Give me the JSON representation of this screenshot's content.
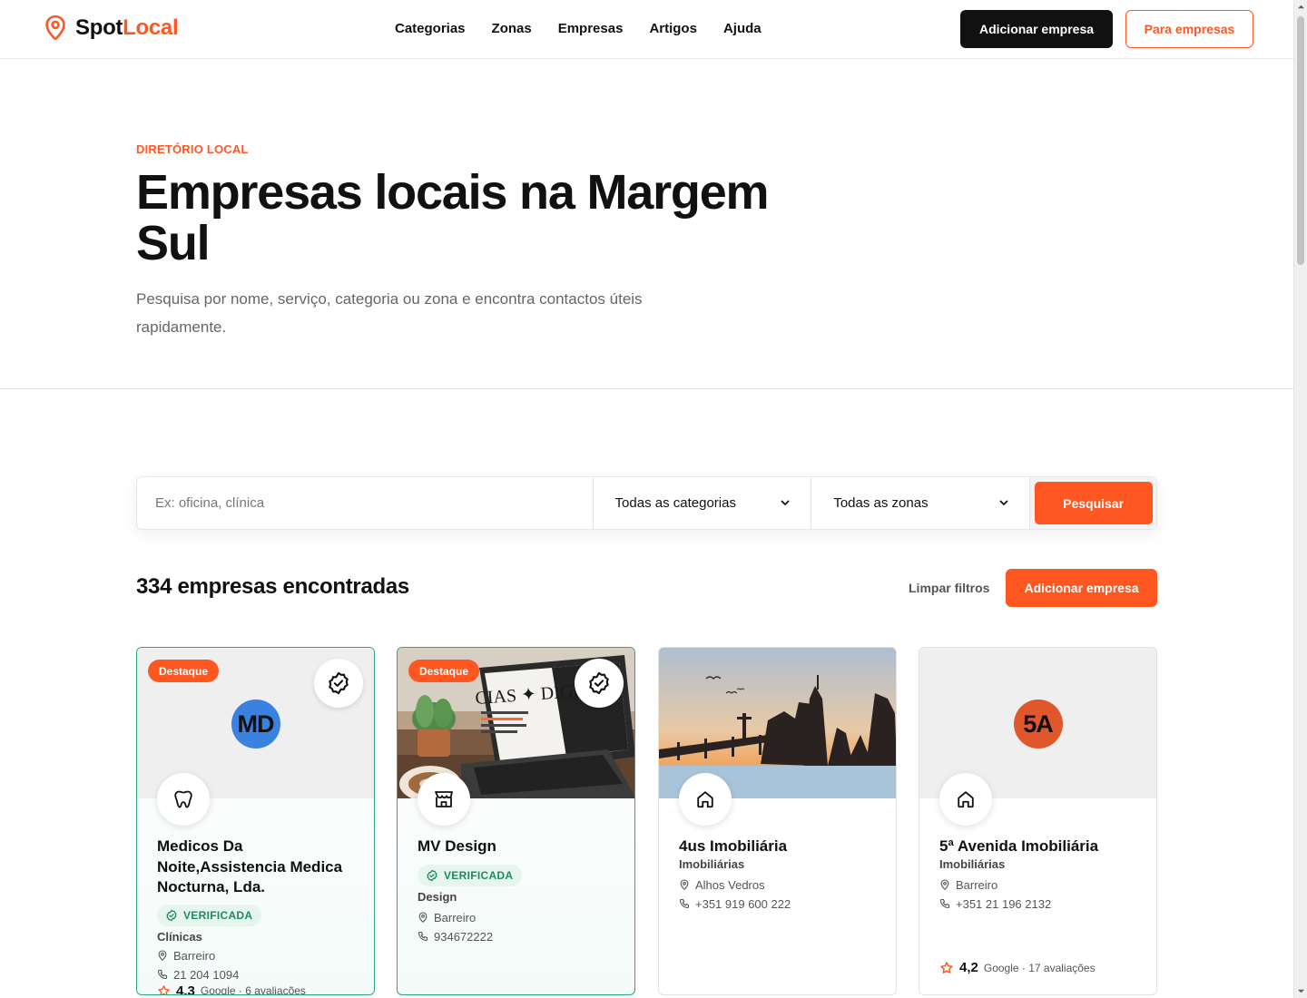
{
  "brand": {
    "part1": "Spot",
    "part2": "Local",
    "accent": "#ff5722"
  },
  "nav": [
    "Categorias",
    "Zonas",
    "Empresas",
    "Artigos",
    "Ajuda"
  ],
  "header": {
    "add_business": "Adicionar empresa",
    "for_business": "Para empresas"
  },
  "hero": {
    "eyebrow": "DIRETÓRIO LOCAL",
    "title": "Empresas locais na Margem Sul",
    "subtitle": "Pesquisa por nome, serviço, categoria ou zona e encontra contactos úteis rapidamente."
  },
  "search": {
    "placeholder": "Ex: oficina, clínica",
    "category_selected": "Todas as categorias",
    "zone_selected": "Todas as zonas",
    "button": "Pesquisar"
  },
  "results": {
    "count_text": "334 empresas encontradas",
    "clear_filters": "Limpar filtros",
    "add_business": "Adicionar empresa"
  },
  "cards": [
    {
      "featured_label": "Destaque",
      "avatar_initials": "MD",
      "avatar_color": "#3b82e0",
      "category_icon": "tooth-icon",
      "title": "Medicos Da Noite,Assistencia Medica Nocturna, Lda.",
      "verified_label": "VERIFICADA",
      "category": "Clínicas",
      "location": "Barreiro",
      "phone": "21 204 1094",
      "rating": "4,3",
      "rating_source": "Google · 6 avaliações"
    },
    {
      "featured_label": "Destaque",
      "category_icon": "store-icon",
      "title": "MV Design",
      "verified_label": "VERIFICADA",
      "category": "Design",
      "location": "Barreiro",
      "phone": "934672222",
      "image_text": "CIAS ✦ DIGIT"
    },
    {
      "category_icon": "home-icon",
      "title": "4us Imobiliária",
      "category": "Imobiliárias",
      "location": "Alhos Vedros",
      "phone": "+351 919 600 222"
    },
    {
      "avatar_initials": "5A",
      "avatar_color": "#e0572c",
      "category_icon": "home-icon",
      "title": "5ª Avenida Imobiliária",
      "category": "Imobiliárias",
      "location": "Barreiro",
      "phone": "+351 21 196 2132",
      "rating": "4,2",
      "rating_source": "Google · 17 avaliações"
    }
  ]
}
